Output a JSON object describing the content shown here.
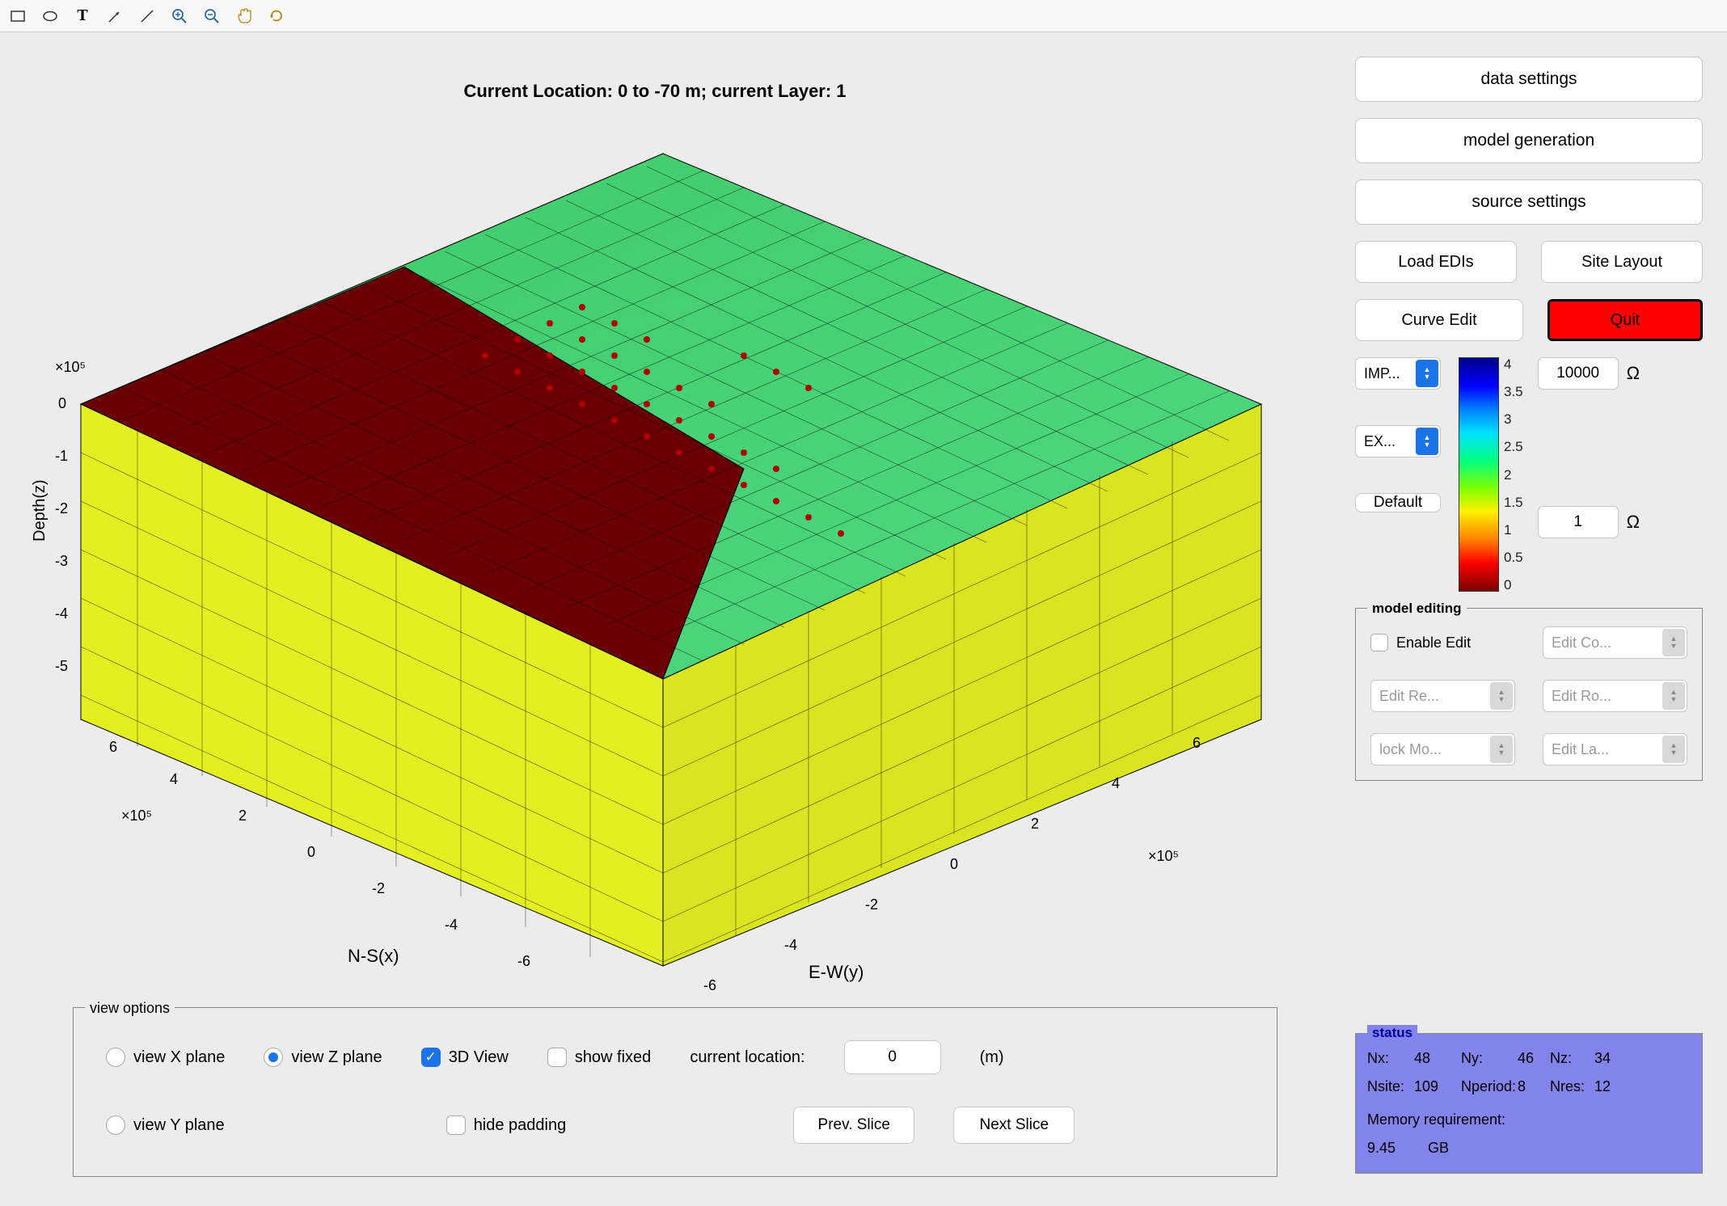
{
  "plot": {
    "title": "Current Location: 0 to -70 m; current Layer: 1",
    "x_axis_label": "N-S(x)",
    "y_axis_label": "E-W(y)",
    "z_axis_label": "Depth(z)",
    "xy_scale": "×10⁵",
    "z_scale": "×10⁵",
    "xy_ticks": [
      "-6",
      "-4",
      "-2",
      "0",
      "2",
      "4",
      "6"
    ],
    "z_ticks": [
      "0",
      "-1",
      "-2",
      "-3",
      "-4",
      "-5"
    ]
  },
  "toolbar": {
    "icons": [
      "rectangle",
      "ellipse",
      "text",
      "arrow",
      "line",
      "zoom-in",
      "zoom-out",
      "pan",
      "restore"
    ]
  },
  "side": {
    "data_settings": "data settings",
    "model_generation": "model generation",
    "source_settings": "source settings",
    "load_edis": "Load EDIs",
    "site_layout": "Site Layout",
    "curve_edit": "Curve Edit",
    "quit": "Quit",
    "imp_sel": "IMP...",
    "exp_sel": "EX...",
    "default_btn": "Default",
    "upper_ohm_value": "10000",
    "lower_ohm_value": "1",
    "ohm_unit": "Ω",
    "colorbar_ticks": [
      "4",
      "3.5",
      "3",
      "2.5",
      "2",
      "1.5",
      "1",
      "0.5",
      "0"
    ]
  },
  "model_editing": {
    "title": "model editing",
    "enable_edit": "Enable Edit",
    "edit_co": "Edit Co...",
    "edit_re": "Edit Re...",
    "edit_ro": "Edit Ro...",
    "lock_mo": "lock Mo...",
    "edit_la": "Edit La..."
  },
  "status": {
    "title": "status",
    "nx_label": "Nx:",
    "nx": "48",
    "ny_label": "Ny:",
    "ny": "46",
    "nz_label": "Nz:",
    "nz": "34",
    "nsite_label": "Nsite:",
    "nsite": "109",
    "nperiod_label": "Nperiod:",
    "nperiod": "8",
    "nres_label": "Nres:",
    "nres": "12",
    "mem_label": "Memory requirement:",
    "mem_value": "9.45",
    "mem_unit": "GB"
  },
  "view_options": {
    "title": "view options",
    "view_x": "view X plane",
    "view_z": "view Z plane",
    "view_y": "view Y plane",
    "three_d": "3D View",
    "hide_padding": "hide padding",
    "show_fixed": "show fixed",
    "cur_loc_label": "current location:",
    "cur_loc_value": "0",
    "cur_loc_unit": "(m)",
    "prev": "Prev. Slice",
    "next": "Next Slice"
  }
}
